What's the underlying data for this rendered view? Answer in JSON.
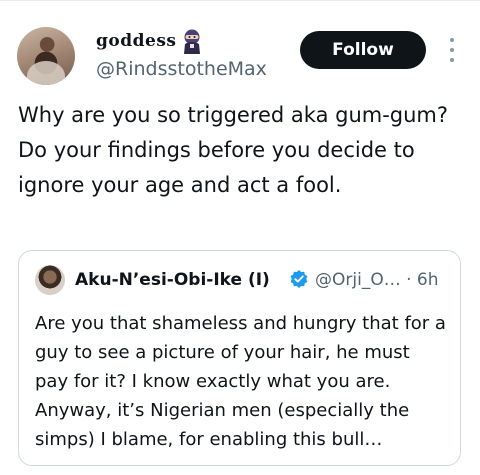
{
  "tweet": {
    "author": {
      "display_name": "goddess",
      "name_emoji": "ninja-emoji",
      "handle": "@RindsstotheMax"
    },
    "follow_label": "Follow",
    "text": "Why are you so triggered aka gum-gum? Do your findings before you decide to ignore your age and act a fool."
  },
  "quoted_tweet": {
    "display_name": "Aku-N’esi-Obi-Ike (I)",
    "verified": true,
    "handle": "@Orji_O…",
    "separator": "·",
    "time": "6h",
    "text": "Are you that shameless and hungry that for a guy to see a picture of your hair, he must pay for it? I know exactly what you are. Anyway, it’s Nigerian men (especially the simps) I blame, for enabling this bull…"
  },
  "colors": {
    "follow_bg": "#0f1419",
    "secondary_text": "#536471",
    "verified_blue": "#1d9bf0",
    "card_border": "#cfd9de"
  }
}
